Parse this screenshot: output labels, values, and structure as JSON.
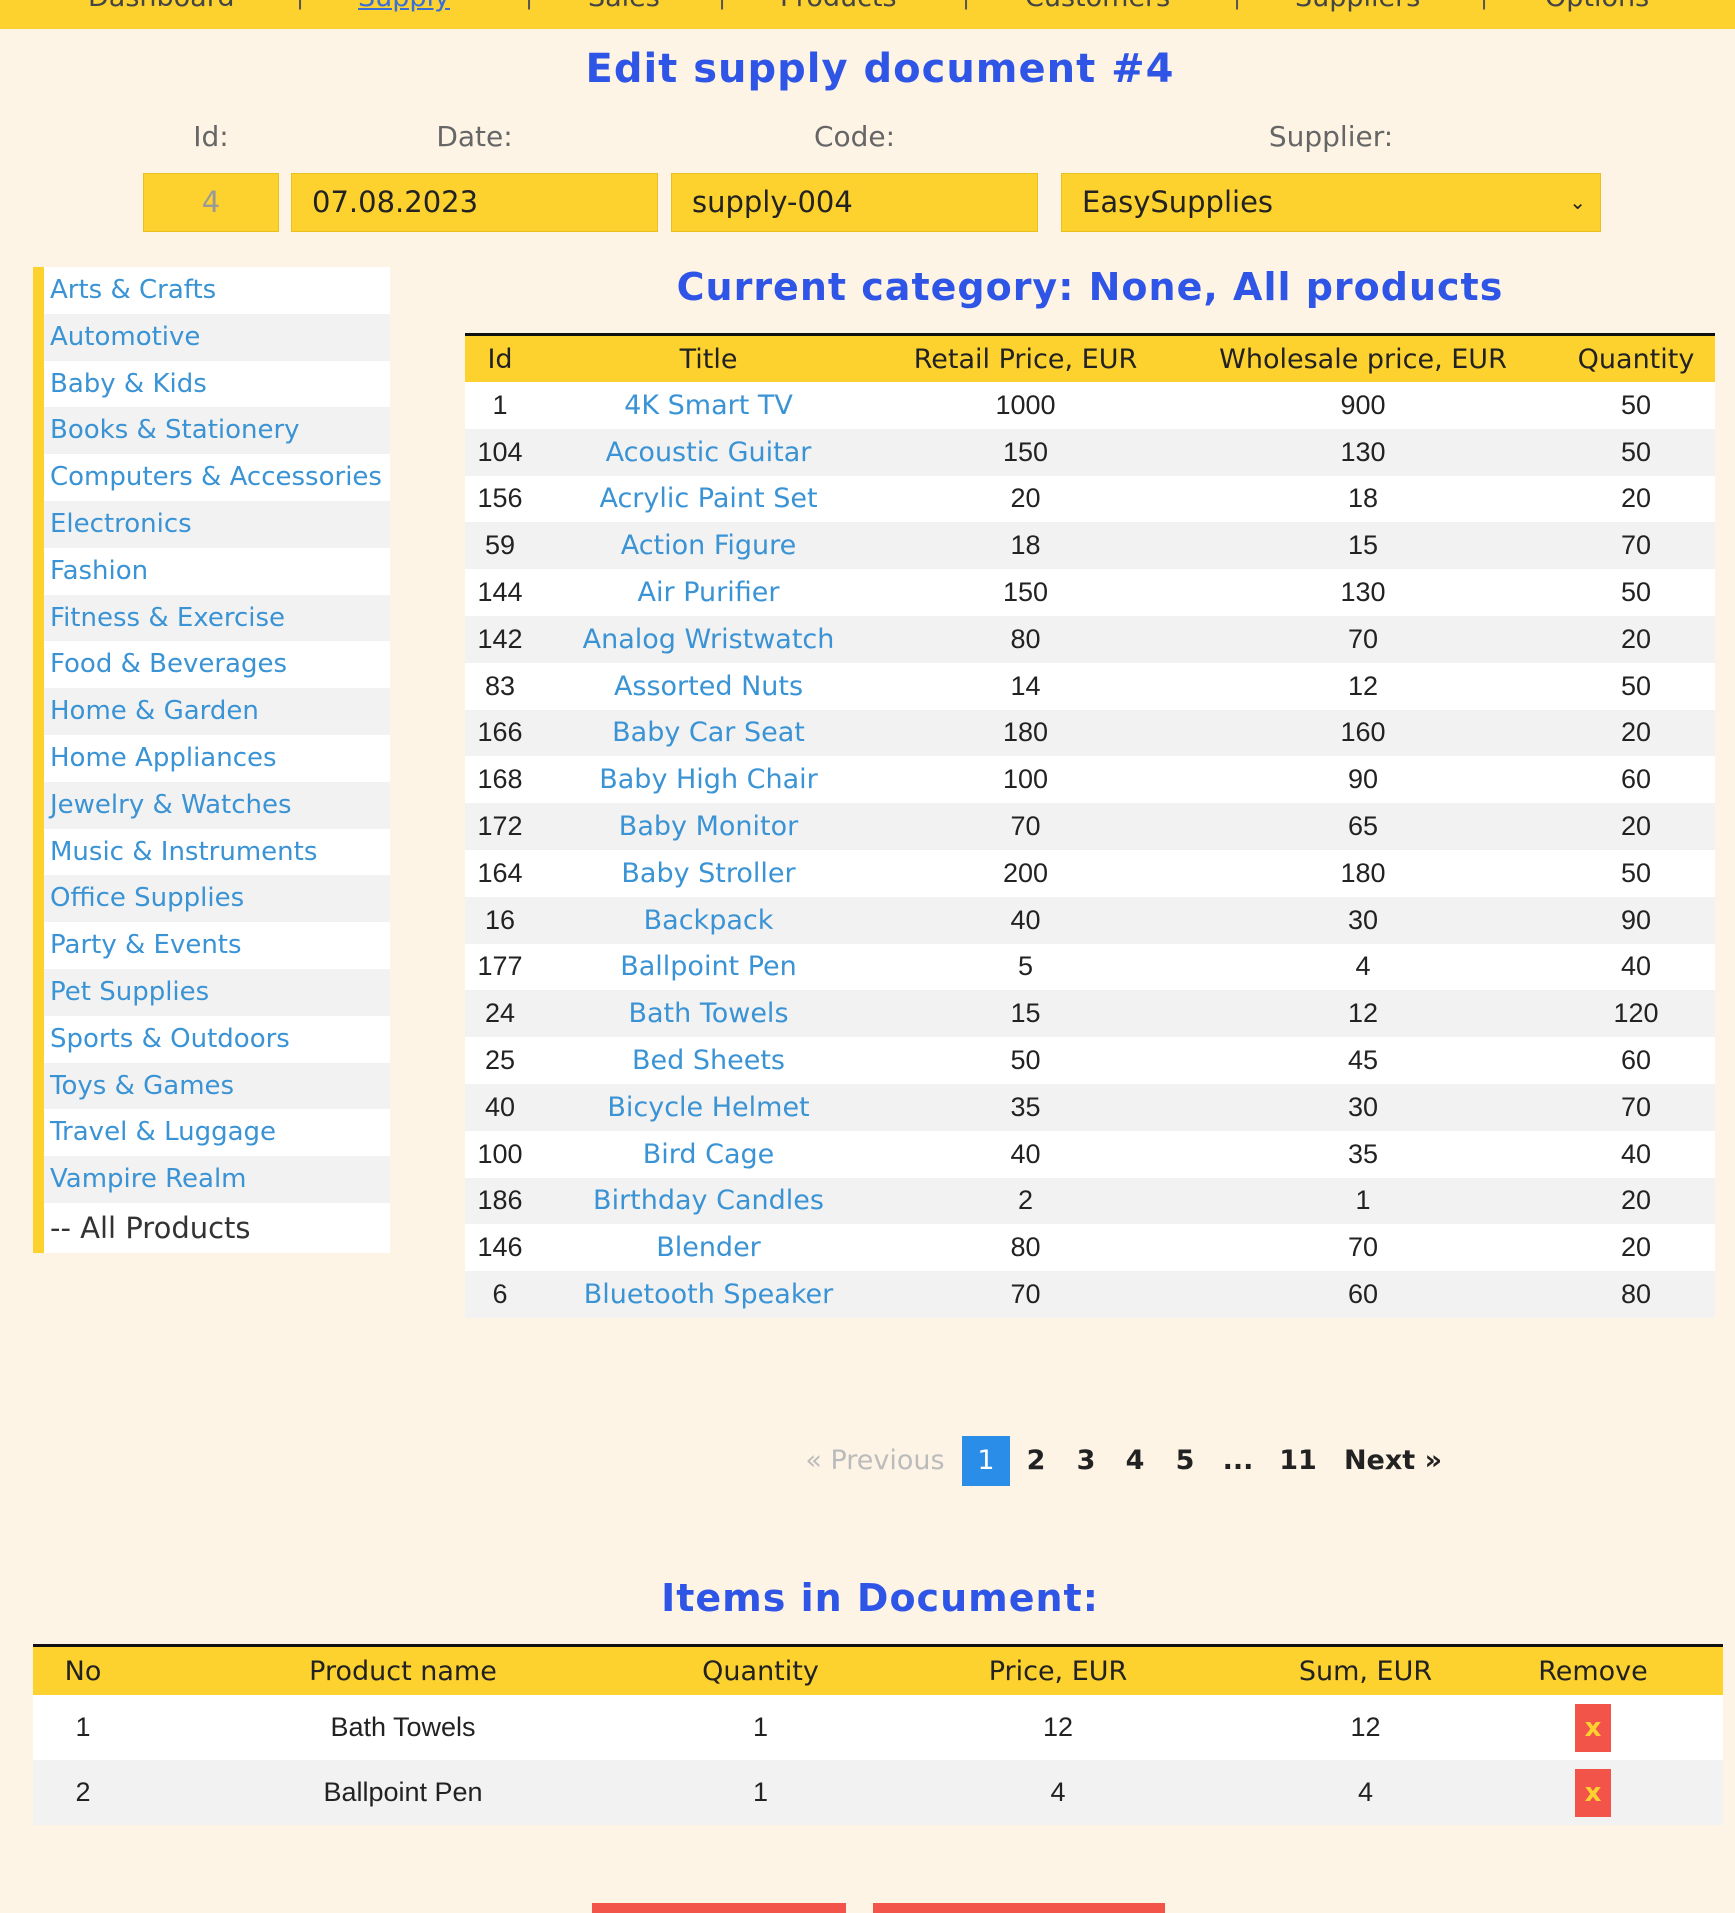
{
  "nav": {
    "items": [
      "Dashboard",
      "Supply",
      "Sales",
      "Products",
      "Customers",
      "Suppliers",
      "Options"
    ],
    "active": "Supply"
  },
  "page_title": "Edit supply document #4",
  "form": {
    "id_label": "Id:",
    "id_value": "4",
    "date_label": "Date:",
    "date_value": "07.08.2023",
    "code_label": "Code:",
    "code_value": "supply-004",
    "supplier_label": "Supplier:",
    "supplier_value": "EasySupplies"
  },
  "categories": [
    "Arts & Crafts",
    "Automotive",
    "Baby & Kids",
    "Books & Stationery",
    "Computers & Accessories",
    "Electronics",
    "Fashion",
    "Fitness & Exercise",
    "Food & Beverages",
    "Home & Garden",
    "Home Appliances",
    "Jewelry & Watches",
    "Music & Instruments",
    "Office Supplies",
    "Party & Events",
    "Pet Supplies",
    "Sports & Outdoors",
    "Toys & Games",
    "Travel & Luggage",
    "Vampire Realm",
    "-- All Products"
  ],
  "current_category_title": "Current category: None, All products",
  "products_table": {
    "headers": [
      "Id",
      "Title",
      "Retail Price, EUR",
      "Wholesale price, EUR",
      "Quantity"
    ],
    "rows": [
      [
        "1",
        "4K Smart TV",
        "1000",
        "900",
        "50"
      ],
      [
        "104",
        "Acoustic Guitar",
        "150",
        "130",
        "50"
      ],
      [
        "156",
        "Acrylic Paint Set",
        "20",
        "18",
        "20"
      ],
      [
        "59",
        "Action Figure",
        "18",
        "15",
        "70"
      ],
      [
        "144",
        "Air Purifier",
        "150",
        "130",
        "50"
      ],
      [
        "142",
        "Analog Wristwatch",
        "80",
        "70",
        "20"
      ],
      [
        "83",
        "Assorted Nuts",
        "14",
        "12",
        "50"
      ],
      [
        "166",
        "Baby Car Seat",
        "180",
        "160",
        "20"
      ],
      [
        "168",
        "Baby High Chair",
        "100",
        "90",
        "60"
      ],
      [
        "172",
        "Baby Monitor",
        "70",
        "65",
        "20"
      ],
      [
        "164",
        "Baby Stroller",
        "200",
        "180",
        "50"
      ],
      [
        "16",
        "Backpack",
        "40",
        "30",
        "90"
      ],
      [
        "177",
        "Ballpoint Pen",
        "5",
        "4",
        "40"
      ],
      [
        "24",
        "Bath Towels",
        "15",
        "12",
        "120"
      ],
      [
        "25",
        "Bed Sheets",
        "50",
        "45",
        "60"
      ],
      [
        "40",
        "Bicycle Helmet",
        "35",
        "30",
        "70"
      ],
      [
        "100",
        "Bird Cage",
        "40",
        "35",
        "40"
      ],
      [
        "186",
        "Birthday Candles",
        "2",
        "1",
        "20"
      ],
      [
        "146",
        "Blender",
        "80",
        "70",
        "20"
      ],
      [
        "6",
        "Bluetooth Speaker",
        "70",
        "60",
        "80"
      ]
    ]
  },
  "pagination": {
    "prev": "«  Previous",
    "pages": [
      "1",
      "2",
      "3",
      "4",
      "5",
      "...",
      "11"
    ],
    "current": "1",
    "next": "Next  »"
  },
  "items_title": "Items in Document:",
  "items_table": {
    "headers": [
      "No",
      "Product name",
      "Quantity",
      "Price, EUR",
      "Sum, EUR",
      "Remove"
    ],
    "rows": [
      [
        "1",
        "Bath Towels",
        "1",
        "12",
        "12"
      ],
      [
        "2",
        "Ballpoint Pen",
        "1",
        "4",
        "4"
      ]
    ],
    "remove_label": "x"
  },
  "colors": {
    "accent_yellow": "#fdd22f",
    "title_blue": "#2f55e6",
    "link_blue": "#3a93d4",
    "danger_red": "#f2544a",
    "background": "#fdf4e6"
  }
}
